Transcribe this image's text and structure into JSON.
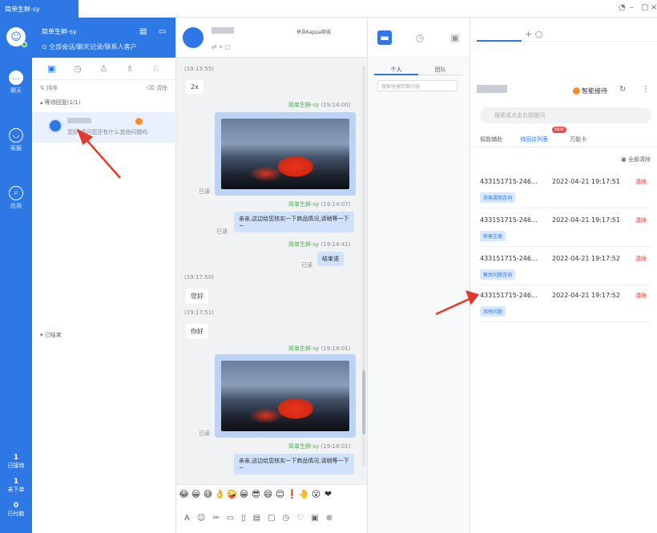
{
  "window": {
    "app_tab": "简单生鲜-sy"
  },
  "rail": {
    "items": [
      {
        "label": "聊天",
        "icon": "chat-icon"
      },
      {
        "label": "客服",
        "icon": "headset-icon"
      },
      {
        "label": "应用",
        "icon": "search-icon"
      }
    ],
    "stats": [
      {
        "num": "1",
        "label": "已接待"
      },
      {
        "num": "1",
        "label": "未下单"
      },
      {
        "num": "0",
        "label": "已付款"
      }
    ]
  },
  "list_panel": {
    "account": "简单生鲜-sy",
    "subtitle": "全部会话/聊天记录/联系人客户",
    "sort_label": "排序",
    "clear_label": "清除",
    "group_waiting": "等待回复(1/1)",
    "conversation_preview": "您好,请问您还有什么其他问题吗",
    "group_finished": "已结束"
  },
  "chat": {
    "title": "来自Kappa商城",
    "messages": [
      {
        "time": "(19:13:55)",
        "text": "2x"
      },
      {
        "sender": "简单生鲜-sy",
        "time": "(19:14:00)",
        "read": "已读"
      },
      {
        "sender": "简单生鲜-sy",
        "time": "(19:14:07)",
        "text": "亲亲,这边给您核实一下商品情况,请稍等一下~",
        "read": "已读"
      },
      {
        "sender": "简单生鲜-sy",
        "time": "(19:14:41)",
        "text": "结束语",
        "read": "已读"
      },
      {
        "time": "(19:17:50)",
        "text": "您好"
      },
      {
        "time": "(19:17:51)",
        "text": "你好"
      },
      {
        "sender": "简单生鲜-sy",
        "time": "(19:18:01)",
        "read": "已读"
      },
      {
        "sender": "简单生鲜-sy",
        "time": "(19:18:01)",
        "text": "亲亲,这边给您核实一下商品情况,请稍等一下~"
      }
    ],
    "emojis": [
      "😂",
      "😀",
      "😅",
      "👌",
      "🤪",
      "😀",
      "😎",
      "😄",
      "😊",
      "❗",
      "🤚",
      "😮",
      "❤"
    ]
  },
  "middle": {
    "seg": [
      "个人",
      "团队"
    ],
    "search_placeholder": "搜索快捷回复内容"
  },
  "right_panel": {
    "tab_label": "",
    "smart_label": "智能接待",
    "search_placeholder": "搜索或点击右侧提问",
    "subtabs": [
      "智能辅助",
      "待回访列表",
      "万能卡"
    ],
    "new_badge": "NEW",
    "close_all": "全部清除",
    "cards": [
      {
        "id": "433151715-246...",
        "date": "2022-04-21 19:17:51",
        "action": "清除",
        "tag": "获客通用咨询"
      },
      {
        "id": "433151715-246...",
        "date": "2022-04-21 19:17:51",
        "action": "清除",
        "tag": "新客注册"
      },
      {
        "id": "433151715-246...",
        "date": "2022-04-21 19:17:52",
        "action": "清除",
        "tag": "售后问题咨询"
      },
      {
        "id": "433151715-246...",
        "date": "2022-04-21 19:17:52",
        "action": "清除",
        "tag": "其他问题"
      }
    ]
  },
  "colors": {
    "brand": "#2e78e6",
    "arrow": "#e3392b",
    "danger": "#e33333"
  }
}
